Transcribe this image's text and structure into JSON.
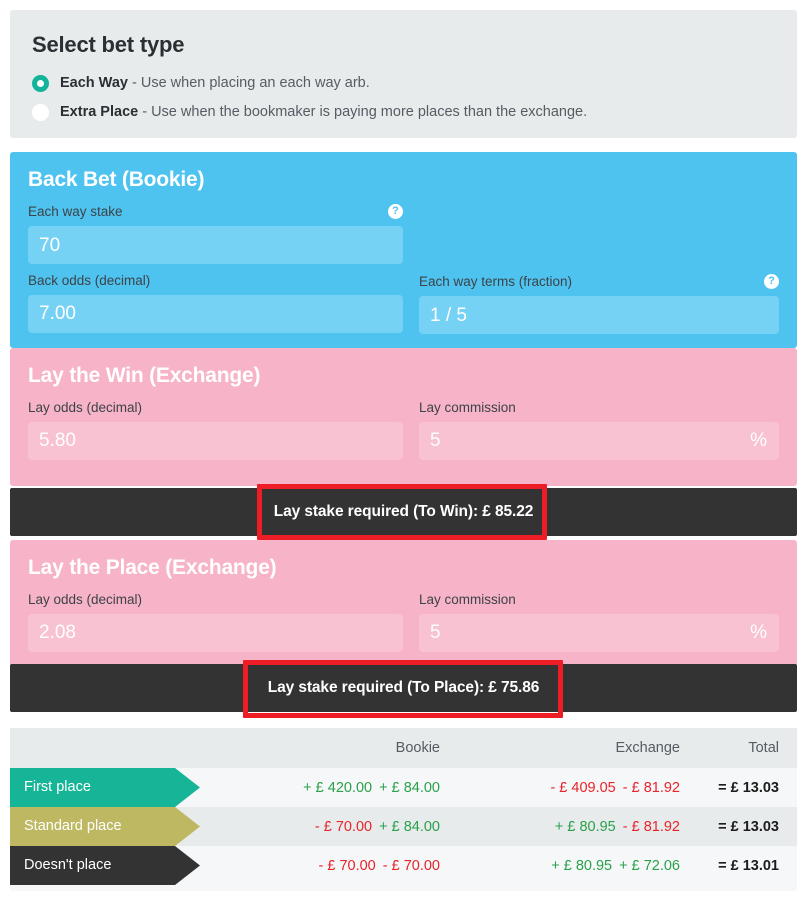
{
  "bet_type": {
    "title": "Select bet type",
    "options": [
      {
        "name": "Each Way",
        "description": " - Use when placing an each way arb.",
        "selected": true
      },
      {
        "name": "Extra Place",
        "description": " - Use when the bookmaker is paying more places than the exchange.",
        "selected": false
      }
    ]
  },
  "back_bet": {
    "title": "Back Bet (Bookie)",
    "stake_label": "Each way stake",
    "stake_value": "70",
    "stake_help": "?",
    "odds_label": "Back odds (decimal)",
    "odds_value": "7.00",
    "terms_label": "Each way terms (fraction)",
    "terms_value": "1 / 5",
    "terms_help": "?"
  },
  "lay_win": {
    "title": "Lay the Win (Exchange)",
    "odds_label": "Lay odds (decimal)",
    "odds_value": "5.80",
    "commission_label": "Lay commission",
    "commission_value": "5",
    "commission_suffix": "%",
    "result": "Lay stake required (To Win): £ 85.22"
  },
  "lay_place": {
    "title": "Lay the Place (Exchange)",
    "odds_label": "Lay odds (decimal)",
    "odds_value": "2.08",
    "commission_label": "Lay commission",
    "commission_value": "5",
    "commission_suffix": "%",
    "result": "Lay stake required (To Place): £ 75.86"
  },
  "results_table": {
    "headers": {
      "blank": "",
      "bookie": "Bookie",
      "exchange": "Exchange",
      "total": "Total"
    },
    "rows": [
      {
        "label": "First place",
        "bookie_1": "+ £ 420.00",
        "bookie_1_sign": "pos",
        "bookie_2": "+ £ 84.00",
        "bookie_2_sign": "pos",
        "exchange_1": "- £ 409.05",
        "exchange_1_sign": "neg",
        "exchange_2": "- £ 81.92",
        "exchange_2_sign": "neg",
        "total": "= £ 13.03"
      },
      {
        "label": "Standard place",
        "bookie_1": "- £ 70.00",
        "bookie_1_sign": "neg",
        "bookie_2": "+ £ 84.00",
        "bookie_2_sign": "pos",
        "exchange_1": "+ £ 80.95",
        "exchange_1_sign": "pos",
        "exchange_2": "- £ 81.92",
        "exchange_2_sign": "neg",
        "total": "= £ 13.03"
      },
      {
        "label": "Doesn't place",
        "bookie_1": "- £ 70.00",
        "bookie_1_sign": "neg",
        "bookie_2": "- £ 70.00",
        "bookie_2_sign": "neg",
        "exchange_1": "+ £ 80.95",
        "exchange_1_sign": "pos",
        "exchange_2": "+ £ 72.06",
        "exchange_2_sign": "pos",
        "total": "= £ 13.01"
      }
    ]
  },
  "colors": {
    "back_section": "#4ec3f0",
    "lay_section": "#f7b3c7",
    "result_bar": "#333333",
    "highlight": "#ee1c25",
    "radio_selected": "#16b39b",
    "row_first": "#17b597",
    "row_standard": "#bdb861",
    "row_none": "#333333",
    "positive": "#2aa04a",
    "negative": "#e8232a"
  }
}
